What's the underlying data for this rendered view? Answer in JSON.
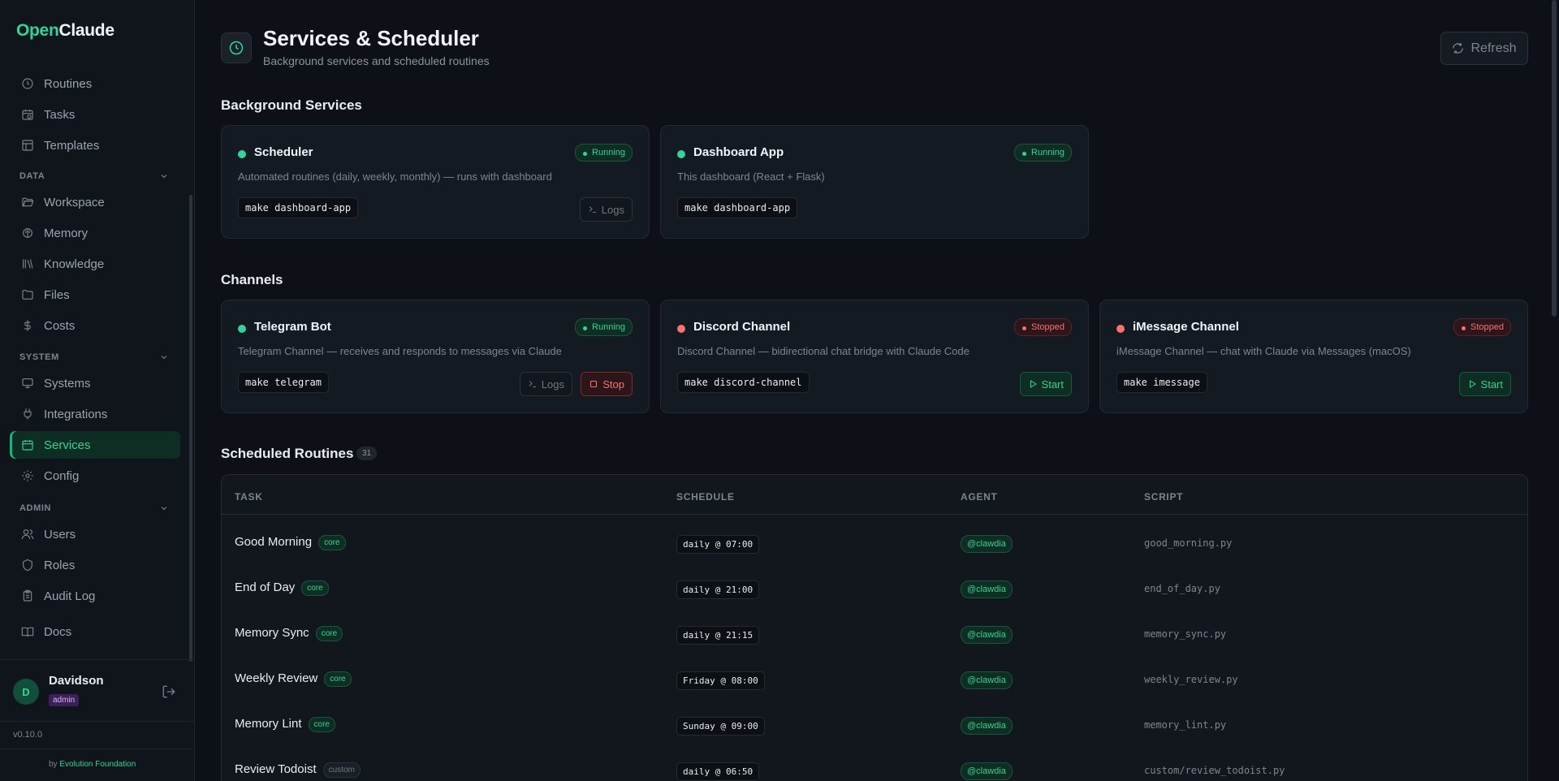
{
  "brand": {
    "part1": "Open",
    "part2": "Claude"
  },
  "sidebar": {
    "top_items": [
      {
        "label": "Routines",
        "icon": "clock-icon"
      },
      {
        "label": "Tasks",
        "icon": "calendar-clock-icon"
      },
      {
        "label": "Templates",
        "icon": "layout-icon"
      }
    ],
    "sections": [
      {
        "title": "DATA",
        "items": [
          {
            "label": "Workspace",
            "icon": "folder-open-icon"
          },
          {
            "label": "Memory",
            "icon": "brain-icon"
          },
          {
            "label": "Knowledge",
            "icon": "library-icon"
          },
          {
            "label": "Files",
            "icon": "folder-icon"
          },
          {
            "label": "Costs",
            "icon": "dollar-icon"
          }
        ]
      },
      {
        "title": "SYSTEM",
        "items": [
          {
            "label": "Systems",
            "icon": "monitor-icon"
          },
          {
            "label": "Integrations",
            "icon": "plug-icon"
          },
          {
            "label": "Services",
            "icon": "calendar-icon",
            "active": true
          },
          {
            "label": "Config",
            "icon": "gear-icon"
          }
        ]
      },
      {
        "title": "ADMIN",
        "items": [
          {
            "label": "Users",
            "icon": "users-icon"
          },
          {
            "label": "Roles",
            "icon": "shield-icon"
          },
          {
            "label": "Audit Log",
            "icon": "clipboard-icon"
          }
        ]
      }
    ],
    "docs": {
      "label": "Docs",
      "icon": "book-icon"
    },
    "user": {
      "initial": "D",
      "name": "Davidson",
      "role": "admin"
    },
    "version": "v0.10.0",
    "byline": {
      "prefix": "by",
      "link": "Evolution Foundation"
    }
  },
  "header": {
    "title": "Services & Scheduler",
    "subtitle": "Background services and scheduled routines",
    "refresh_label": "Refresh"
  },
  "background_services": {
    "title": "Background Services",
    "cards": [
      {
        "name": "Scheduler",
        "status": "Running",
        "desc": "Automated routines (daily, weekly, monthly) — runs with dashboard",
        "cmd": "make dashboard-app",
        "logs": "Logs"
      },
      {
        "name": "Dashboard App",
        "status": "Running",
        "desc": "This dashboard (React + Flask)",
        "cmd": "make dashboard-app"
      }
    ]
  },
  "channels": {
    "title": "Channels",
    "cards": [
      {
        "name": "Telegram Bot",
        "status": "Running",
        "desc": "Telegram Channel — receives and responds to messages via Claude",
        "cmd": "make telegram",
        "logs": "Logs",
        "action": "Stop"
      },
      {
        "name": "Discord Channel",
        "status": "Stopped",
        "desc": "Discord Channel — bidirectional chat bridge with Claude Code",
        "cmd": "make discord-channel",
        "action": "Start"
      },
      {
        "name": "iMessage Channel",
        "status": "Stopped",
        "desc": "iMessage Channel — chat with Claude via Messages (macOS)",
        "cmd": "make imessage",
        "action": "Start"
      }
    ]
  },
  "routines": {
    "title": "Scheduled Routines",
    "count": "31",
    "columns": [
      "TASK",
      "SCHEDULE",
      "AGENT",
      "SCRIPT"
    ],
    "rows": [
      {
        "task": "Good Morning",
        "tag": "core",
        "schedule": "daily @ 07:00",
        "agent": "@clawdia",
        "script": "good_morning.py"
      },
      {
        "task": "End of Day",
        "tag": "core",
        "schedule": "daily @ 21:00",
        "agent": "@clawdia",
        "script": "end_of_day.py"
      },
      {
        "task": "Memory Sync",
        "tag": "core",
        "schedule": "daily @ 21:15",
        "agent": "@clawdia",
        "script": "memory_sync.py"
      },
      {
        "task": "Weekly Review",
        "tag": "core",
        "schedule": "Friday @ 08:00",
        "agent": "@clawdia",
        "script": "weekly_review.py"
      },
      {
        "task": "Memory Lint",
        "tag": "core",
        "schedule": "Sunday @ 09:00",
        "agent": "@clawdia",
        "script": "memory_lint.py"
      },
      {
        "task": "Review Todoist",
        "tag": "custom",
        "schedule": "daily @ 06:50",
        "agent": "@clawdia",
        "script": "custom/review_todoist.py"
      }
    ]
  }
}
